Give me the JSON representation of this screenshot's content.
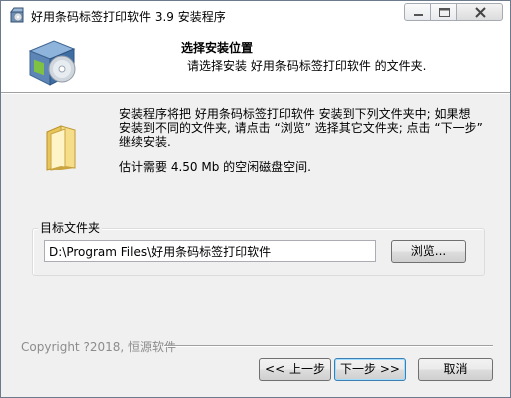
{
  "window": {
    "title": "好用条码标签打印软件 3.9 安装程序",
    "icon": "installer-icon",
    "controls": {
      "minimize_icon": "minimize-icon",
      "maximize_icon": "maximize-icon",
      "close_icon": "close-icon"
    }
  },
  "header": {
    "title": "选择安装位置",
    "subtitle": "请选择安装 好用条码标签打印软件 的文件夹.",
    "icon": "install-box-cd-icon"
  },
  "body": {
    "folder_icon": "folder-icon",
    "description_lines": [
      "安装程序将把 好用条码标签打印软件 安装到下列文件夹中; 如果想",
      "安装到不同的文件夹, 请点击 “浏览” 选择其它文件夹; 点击 “下一步”",
      "继续安装."
    ],
    "space_required": "估计需要 4.50 Mb 的空闲磁盘空间."
  },
  "destination": {
    "label": "目标文件夹",
    "path": "D:\\Program Files\\好用条码标签打印软件",
    "browse_label": "浏览..."
  },
  "footer": {
    "brand": "Copyright  ?2018, 恒源软件",
    "back_label": "<< 上一步",
    "next_label": "下一步 >>",
    "cancel_label": "取消"
  }
}
